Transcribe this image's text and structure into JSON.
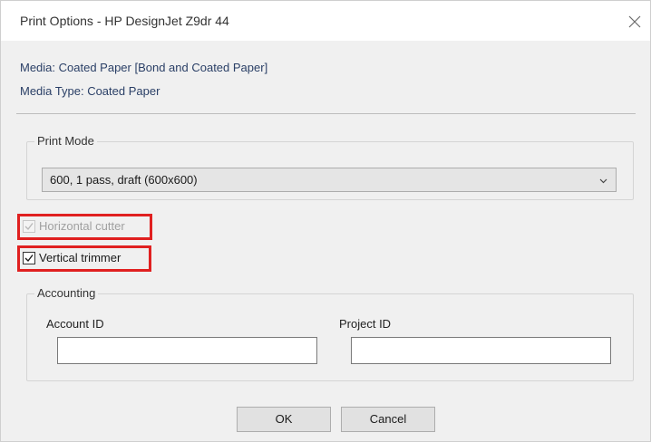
{
  "window": {
    "title": "Print Options - HP DesignJet Z9dr 44"
  },
  "media": {
    "media_line": "Media: Coated Paper [Bond and Coated Paper]",
    "media_type_line": "Media Type: Coated Paper"
  },
  "print_mode": {
    "legend": "Print Mode",
    "selected": "600, 1 pass, draft (600x600)"
  },
  "options": {
    "horizontal_cutter": {
      "label": "Horizontal cutter",
      "checked": true,
      "enabled": false
    },
    "vertical_trimmer": {
      "label": "Vertical trimmer",
      "checked": true,
      "enabled": true
    }
  },
  "accounting": {
    "legend": "Accounting",
    "account_id_label": "Account ID",
    "account_id_value": "",
    "project_id_label": "Project ID",
    "project_id_value": ""
  },
  "buttons": {
    "ok": "OK",
    "cancel": "Cancel"
  },
  "colors": {
    "highlight": "#e02020",
    "info_text": "#2a3f66"
  },
  "icons": {
    "close": "close-icon",
    "dropdown": "chevron-down-icon",
    "check": "checkmark-icon"
  }
}
